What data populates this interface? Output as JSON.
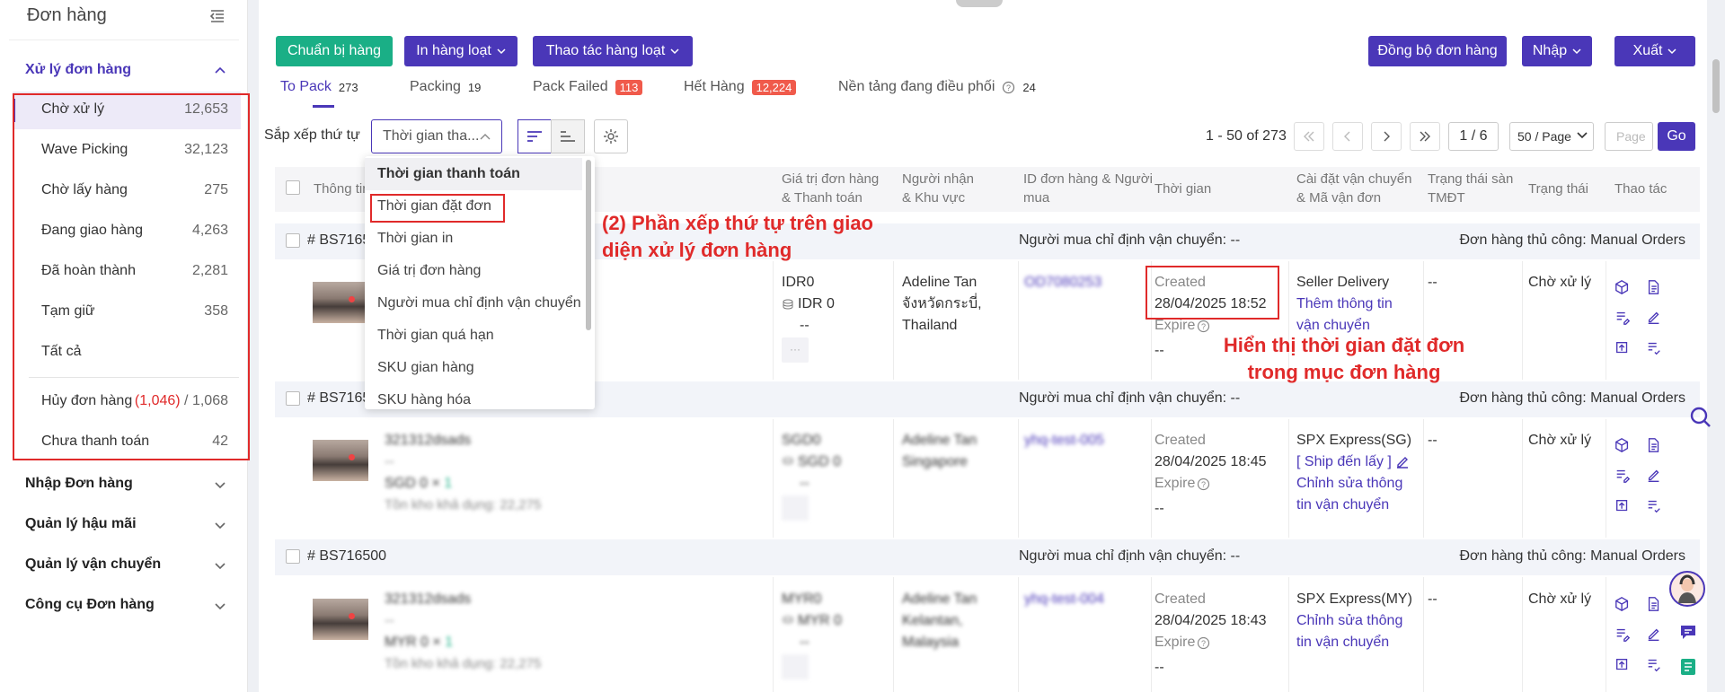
{
  "sidebar": {
    "title": "Đơn hàng",
    "group_orders": "Xử lý đơn hàng",
    "items": [
      {
        "label": "Chờ xử lý",
        "count": "12,653"
      },
      {
        "label": "Wave Picking",
        "count": "32,123"
      },
      {
        "label": "Chờ lấy hàng",
        "count": "275"
      },
      {
        "label": "Đang giao hàng",
        "count": "4,263"
      },
      {
        "label": "Đã hoàn thành",
        "count": "2,281"
      },
      {
        "label": "Tạm giữ",
        "count": "358"
      },
      {
        "label": "Tất cả",
        "count": ""
      }
    ],
    "cancel": {
      "label": "Hủy đơn hàng",
      "count_red": "(1,046)",
      "slash": " / ",
      "total": "1,068"
    },
    "unpaid": {
      "label": "Chưa thanh toán",
      "count": "42"
    },
    "groups": [
      "Nhập Đơn hàng",
      "Quản lý hậu mãi",
      "Quản lý vận chuyển",
      "Công cụ Đơn hàng"
    ]
  },
  "toolbar": {
    "prepare": "Chuẩn bị hàng",
    "bulk_print": "In hàng loạt",
    "bulk_action": "Thao tác hàng loạt",
    "sync": "Đồng bộ đơn hàng",
    "import": "Nhập",
    "export": "Xuất"
  },
  "tabs": [
    {
      "label": "To Pack",
      "count": "273",
      "badge": false
    },
    {
      "label": "Packing",
      "count": "19",
      "badge": false
    },
    {
      "label": "Pack Failed",
      "count": "113",
      "badge": true
    },
    {
      "label": "Hết Hàng",
      "count": "12,224",
      "badge": true
    },
    {
      "label": "Nền tảng đang điều phối",
      "count": "24",
      "badge": false
    }
  ],
  "sort": {
    "label": "Sắp xếp thứ tự",
    "value": "Thời gian tha..."
  },
  "pager": {
    "range": "1 - 50 of 273",
    "current": "1 / 6",
    "size": "50 / Page",
    "page_placeholder": "Page",
    "go": "Go"
  },
  "columns": {
    "info": "Thông tin",
    "value": [
      "Giá trị đơn hàng",
      "& Thanh toán"
    ],
    "recipient": [
      "Người nhận",
      "& Khu vực"
    ],
    "orderid": [
      "ID đơn hàng & Người",
      "mua"
    ],
    "time": "Thời gian",
    "shipping": [
      "Cài đặt vận chuyển",
      "& Mã vận đơn"
    ],
    "platform": [
      "Trạng thái sàn",
      "TMĐT"
    ],
    "status": "Trạng thái",
    "actions": "Thao tác"
  },
  "dropdown": {
    "options": [
      "Thời gian thanh toán",
      "Thời gian đặt đơn",
      "Thời gian in",
      "Giá trị đơn hàng",
      "Người mua chỉ định vận chuyển",
      "Thời gian quá hạn",
      "SKU gian hàng",
      "SKU hàng hóa"
    ]
  },
  "orders": [
    {
      "id": "# BS7165",
      "buyer_ship": "Người mua chỉ định vận chuyển: --",
      "manual": "Đơn hàng thủ công: Manual Orders",
      "value1": "IDR0",
      "value2": "IDR 0",
      "value3": "--",
      "recipient": [
        "Adeline Tan",
        "จังหวัดกระบี่,",
        "Thailand"
      ],
      "order_id": "OD7080253",
      "created_label": "Created",
      "created": "28/04/2025 18:52",
      "expire": "Expire",
      "expire_val": "--",
      "ship1": "Seller Delivery",
      "ship2": "Thêm thông tin",
      "ship3": "vận chuyển",
      "platform": "--",
      "status": "Chờ xử lý"
    },
    {
      "id": "# BS7165",
      "buyer_ship": "Người mua chỉ định vận chuyển: --",
      "manual": "Đơn hàng thủ công: Manual Orders",
      "product": "321312dsads",
      "dash": "--",
      "price": "SGD 0",
      "qty_x": "×",
      "qty": "1",
      "stock": "Tồn kho khả dụng: 22,275",
      "value1": "SGD0",
      "value2": "SGD 0",
      "value3": "--",
      "recipient": [
        "Adeline Tan",
        "Singapore"
      ],
      "order_id": "yhq-test-005",
      "created_label": "Created",
      "created": "28/04/2025 18:45",
      "expire": "Expire",
      "expire_val": "--",
      "ship1": "SPX Express(SG)",
      "ship_tag": "[ Ship đến lấy ]",
      "ship2": "Chỉnh sửa thông",
      "ship3": "tin vận chuyển",
      "platform": "--",
      "status": "Chờ xử lý"
    },
    {
      "id": "# BS716500",
      "buyer_ship": "Người mua chỉ định vận chuyển: --",
      "manual": "Đơn hàng thủ công: Manual Orders",
      "product": "321312dsads",
      "dash": "--",
      "price": "MYR 0",
      "qty_x": "×",
      "qty": "1",
      "stock": "Tồn kho khả dụng: 22,275",
      "value1": "MYR0",
      "value2": "MYR 0",
      "value3": "--",
      "recipient": [
        "Adeline Tan",
        "Kelantan,",
        "Malaysia"
      ],
      "order_id": "yhq-test-004",
      "created_label": "Created",
      "created": "28/04/2025 18:43",
      "expire": "Expire",
      "expire_val": "--",
      "ship1": "SPX Express(MY)",
      "ship2": "Chỉnh sửa thông",
      "ship3": "tin vận chuyển",
      "platform": "--",
      "status": "Chờ xử lý"
    }
  ],
  "annotations": {
    "a1": [
      "(2) Phần xếp thứ tự trên giao",
      "diện xử lý đơn hàng"
    ],
    "a2": [
      "Hiển thị thời gian đặt đơn",
      "trong mục đơn hàng"
    ]
  },
  "colors": {
    "accent": "#4a37b8",
    "green": "#1aaf86",
    "annotation": "#e02a2a",
    "badge": "#f05a4b"
  }
}
